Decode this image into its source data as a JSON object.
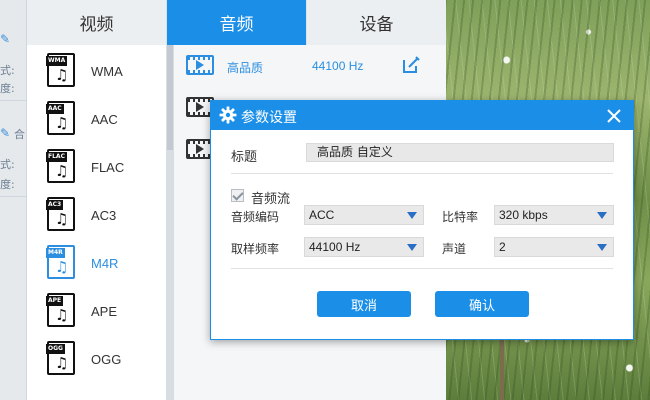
{
  "tabs": [
    {
      "label": "视频",
      "active": false
    },
    {
      "label": "音频",
      "active": true
    },
    {
      "label": "设备",
      "active": false
    }
  ],
  "background_strip": {
    "labels": [
      "式:",
      "度:",
      "式:",
      "度:"
    ],
    "partial_text": "合"
  },
  "formats": [
    {
      "tag": "WMA",
      "label": "WMA",
      "active": false
    },
    {
      "tag": "AAC",
      "label": "AAC",
      "active": false
    },
    {
      "tag": "FLAC",
      "label": "FLAC",
      "active": false
    },
    {
      "tag": "AC3",
      "label": "AC3",
      "active": false
    },
    {
      "tag": "M4R",
      "label": "M4R",
      "active": true
    },
    {
      "tag": "APE",
      "label": "APE",
      "active": false
    },
    {
      "tag": "OGG",
      "label": "OGG",
      "active": false
    }
  ],
  "presets": [
    {
      "quality": "高品质",
      "sample_rate": "44100 Hz",
      "highlighted": true
    }
  ],
  "dialog": {
    "title": "参数设置",
    "title_field_label": "标题",
    "title_field_value": "高品质 自定义",
    "audio_stream_label": "音频流",
    "audio_stream_checked": true,
    "codec_label": "音频编码",
    "codec_value": "ACC",
    "bitrate_label": "比特率",
    "bitrate_value": "320 kbps",
    "samplerate_label": "取样频率",
    "samplerate_value": "44100 Hz",
    "channel_label": "声道",
    "channel_value": "2",
    "cancel_label": "取消",
    "confirm_label": "确认"
  },
  "colors": {
    "accent": "#1b8fe8",
    "select_arrow": "#2b6fc4"
  }
}
